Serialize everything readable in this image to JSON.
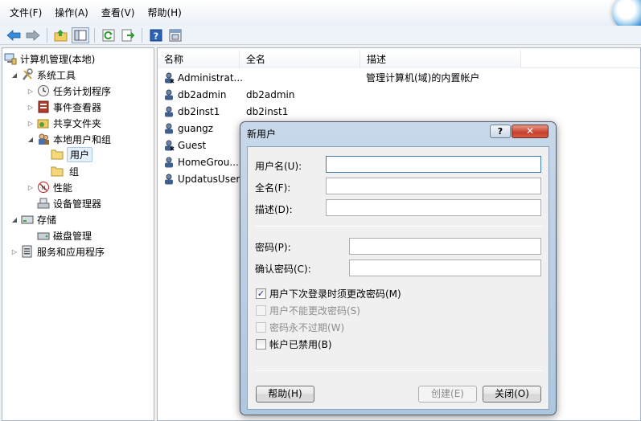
{
  "menu": [
    "文件(F)",
    "操作(A)",
    "查看(V)",
    "帮助(H)"
  ],
  "toolbar_icons": [
    "back-arrow-icon",
    "forward-arrow-icon",
    "up-folder-icon",
    "show-hide-tree-icon",
    "refresh-icon",
    "export-list-icon",
    "help-icon",
    "properties-icon"
  ],
  "tree": {
    "root": "计算机管理(本地)",
    "system_tools": "系统工具",
    "task_scheduler": "任务计划程序",
    "event_viewer": "事件查看器",
    "shared_folders": "共享文件夹",
    "local_users_groups": "本地用户和组",
    "users": "用户",
    "groups": "组",
    "performance": "性能",
    "device_manager": "设备管理器",
    "storage": "存储",
    "disk_management": "磁盘管理",
    "services_apps": "服务和应用程序"
  },
  "list": {
    "columns": [
      "名称",
      "全名",
      "描述"
    ],
    "rows": [
      {
        "name": "Administrat...",
        "fullname": "",
        "desc": "管理计算机(域)的内置帐户"
      },
      {
        "name": "db2admin",
        "fullname": "db2admin",
        "desc": ""
      },
      {
        "name": "db2inst1",
        "fullname": "db2inst1",
        "desc": ""
      },
      {
        "name": "guangz",
        "fullname": "",
        "desc": ""
      },
      {
        "name": "Guest",
        "fullname": "",
        "desc": ""
      },
      {
        "name": "HomeGrou...",
        "fullname": "",
        "desc": ""
      },
      {
        "name": "UpdatusUser",
        "fullname": "",
        "desc": ""
      }
    ]
  },
  "dialog": {
    "title": "新用户",
    "help_btn": "?",
    "close_btn": "✕",
    "username_label": "用户名(U):",
    "fullname_label": "全名(F):",
    "desc_label": "描述(D):",
    "password_label": "密码(P):",
    "confirm_label": "确认密码(C):",
    "username_value": "",
    "fullname_value": "",
    "desc_value": "",
    "password_value": "",
    "confirm_value": "",
    "cb_must_change": "用户下次登录时须更改密码(M)",
    "cb_cannot_change": "用户不能更改密码(S)",
    "cb_never_expires": "密码永不过期(W)",
    "cb_disabled": "帐户已禁用(B)",
    "cb_must_change_checked": true,
    "btn_help": "帮助(H)",
    "btn_create": "创建(E)",
    "btn_close": "关闭(O)"
  }
}
